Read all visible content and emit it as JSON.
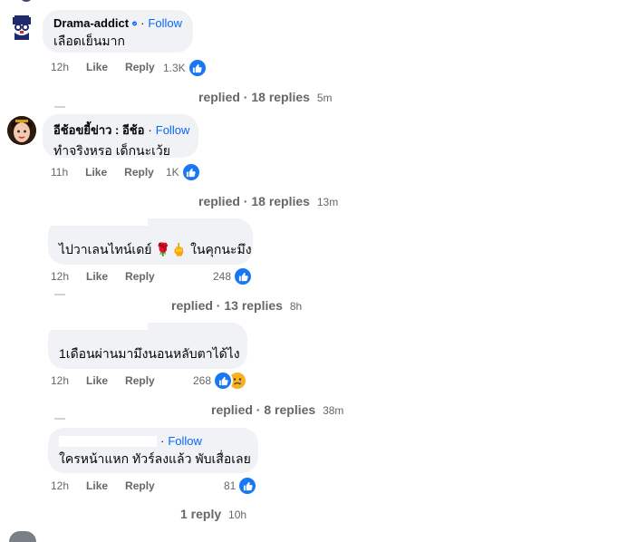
{
  "comments": [
    {
      "author": "Drama-addict",
      "follow_label": "Follow",
      "text": "เลือดเย็นมาก",
      "time": "12h",
      "like_label": "Like",
      "reply_label": "Reply",
      "reaction_count": "1.3K",
      "replies_prefix": "replied",
      "replies_label": "18 replies",
      "replies_ago": "5m"
    },
    {
      "author": "อีช้อขยี้ข่าว : อีช้อ",
      "follow_label": "Follow",
      "text": "ทำจริงหรอ เด็กนะเว้ย",
      "time": "11h",
      "like_label": "Like",
      "reply_label": "Reply",
      "reaction_count": "1K",
      "replies_prefix": "replied",
      "replies_label": "18 replies",
      "replies_ago": "13m"
    },
    {
      "text": "ไปวาเลนไทน์เดย์ 🌹🖕 ในคุกนะมึง",
      "time": "12h",
      "like_label": "Like",
      "reply_label": "Reply",
      "reaction_count": "248",
      "replies_prefix": "replied",
      "replies_label": "13 replies",
      "replies_ago": "8h"
    },
    {
      "text": "1เดือนผ่านมามึงนอนหลับตาได้ไง",
      "time": "12h",
      "like_label": "Like",
      "reply_label": "Reply",
      "reaction_count": "268",
      "replies_prefix": "replied",
      "replies_label": "8 replies",
      "replies_ago": "38m"
    },
    {
      "follow_label": "Follow",
      "text": "ใครหน้าแหก ทัวร์ลงแล้ว พับเสื่อเลย",
      "time": "12h",
      "like_label": "Like",
      "reply_label": "Reply",
      "reaction_count": "81",
      "replies_label": "1 reply",
      "replies_ago": "10h"
    }
  ],
  "colors": {
    "bubble": "#f0f2f5",
    "follow": "#0866ff",
    "like": "#1877f2",
    "meta": "#65676b"
  },
  "icons": [
    "verified-badge-icon",
    "like-reaction-icon",
    "sad-reaction-icon"
  ]
}
